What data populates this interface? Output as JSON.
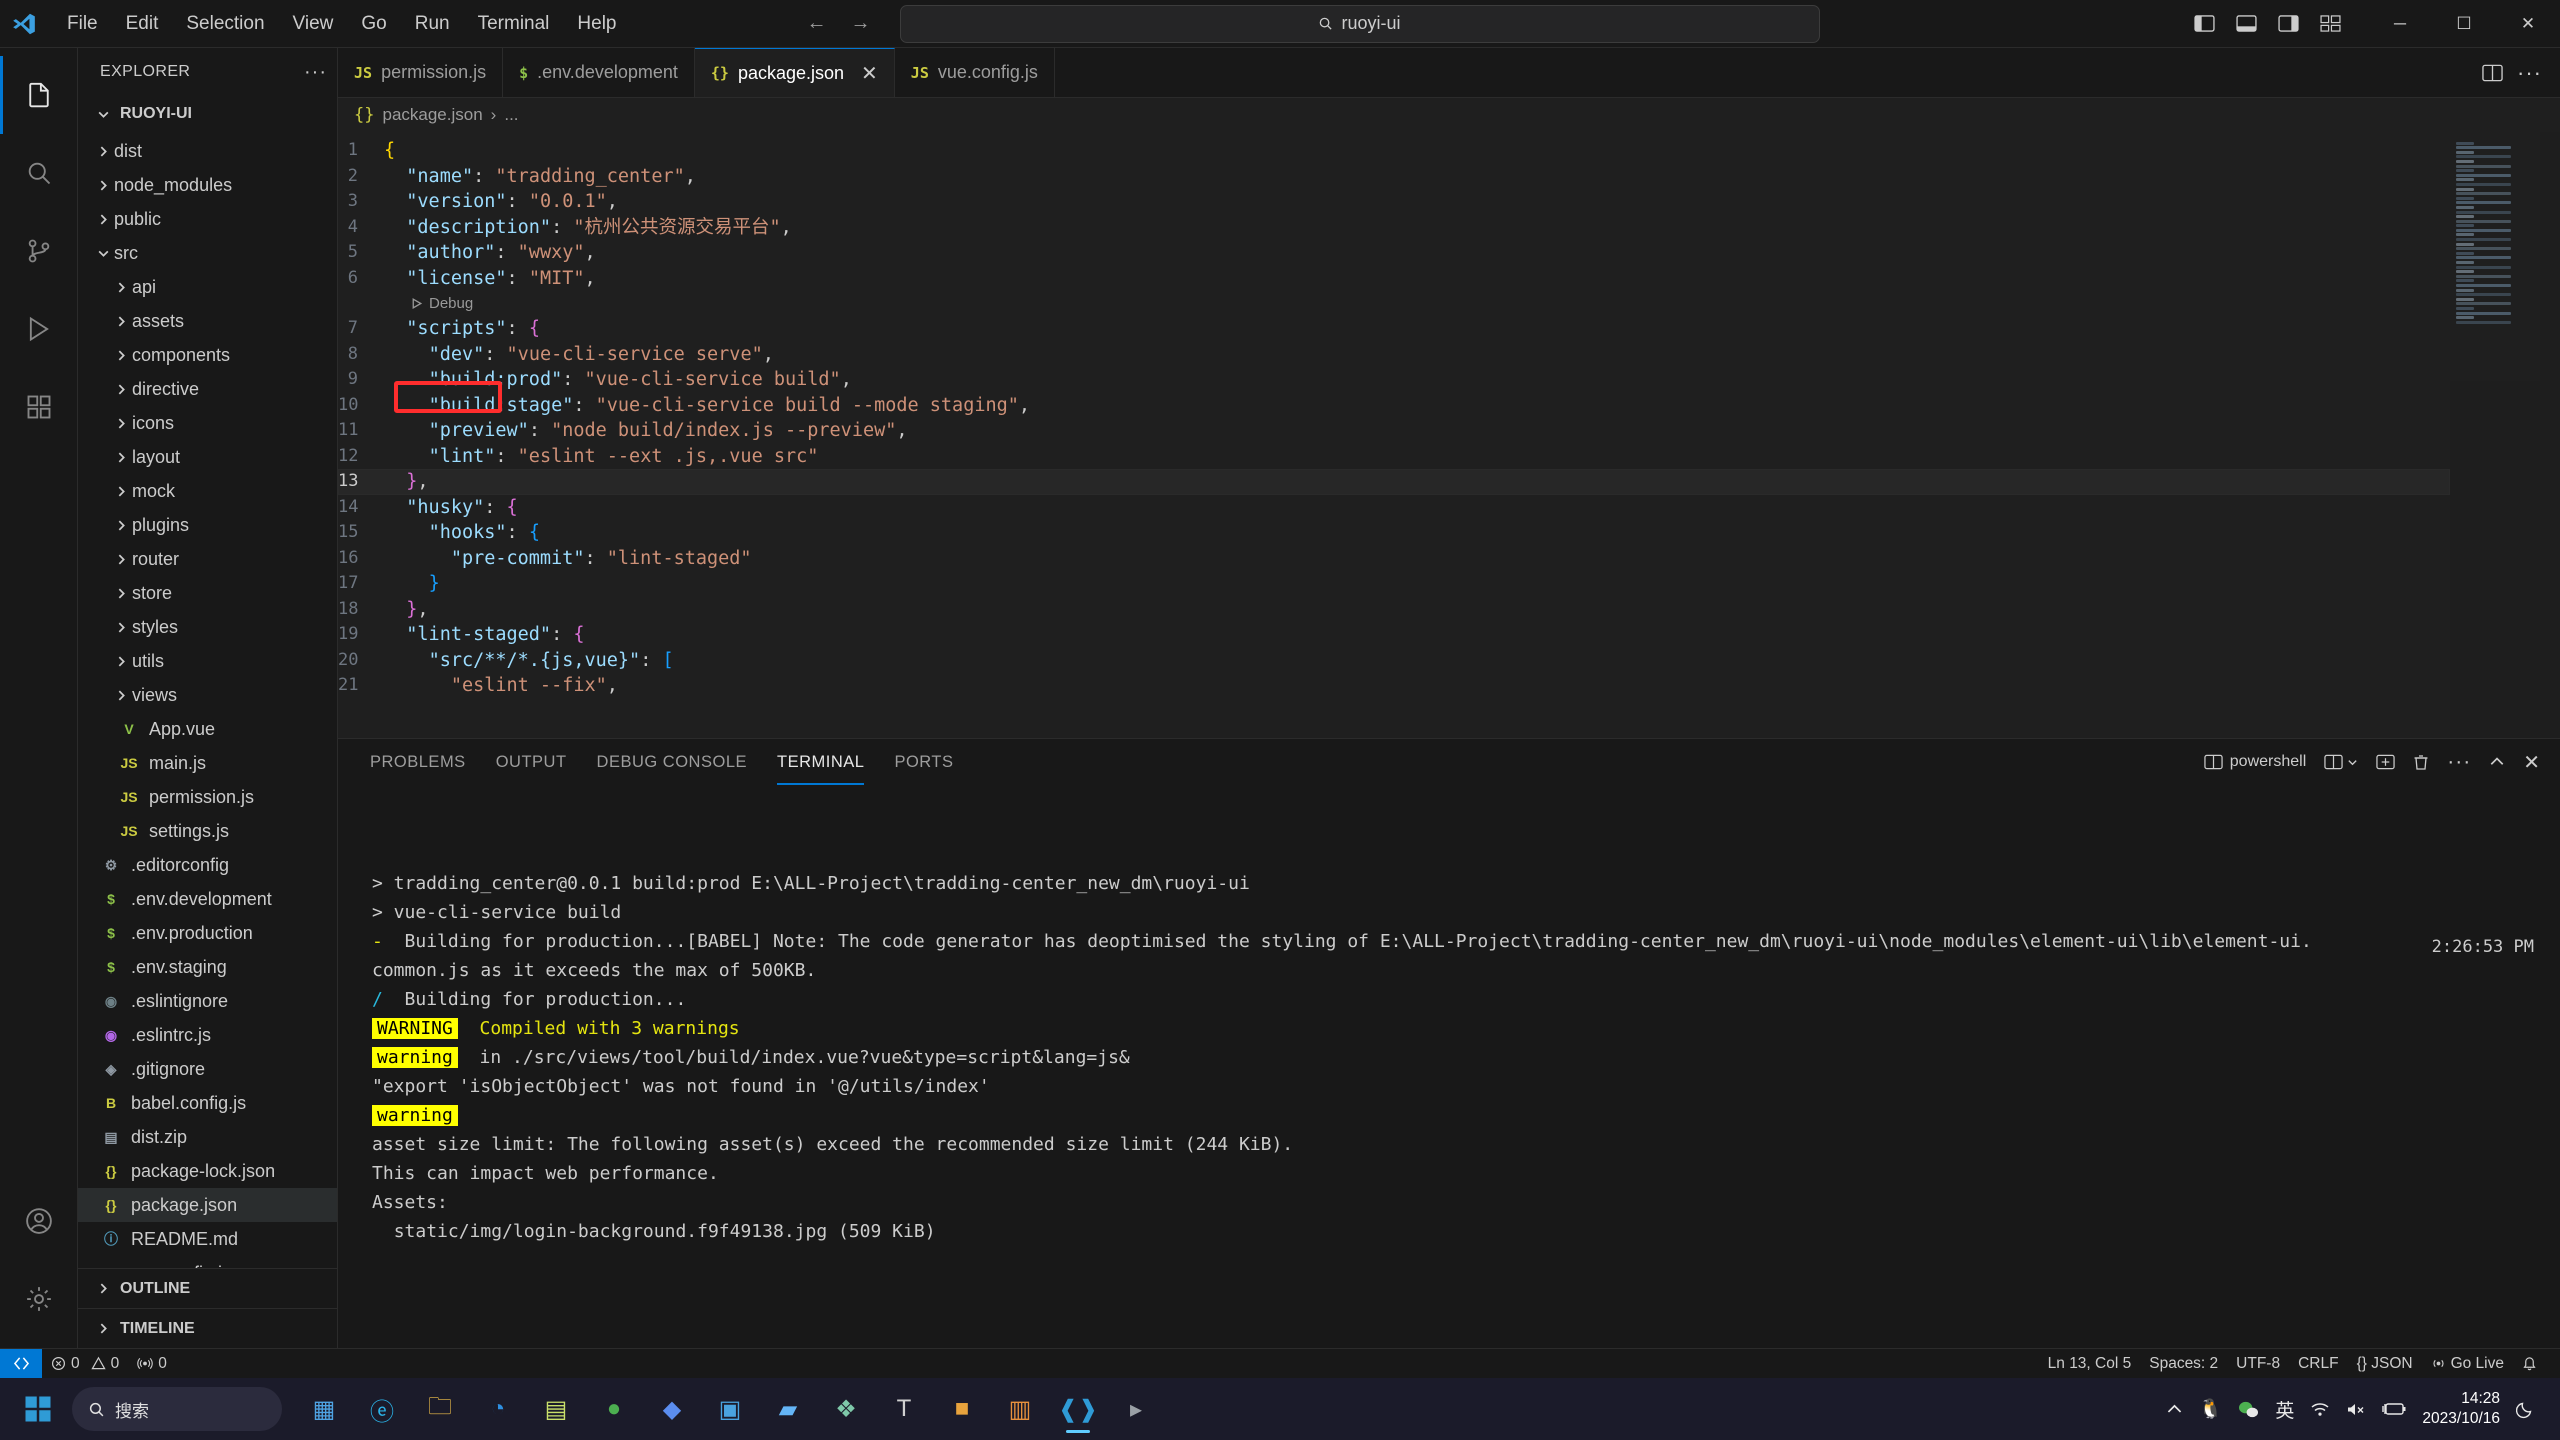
{
  "window": {
    "menu": [
      "File",
      "Edit",
      "Selection",
      "View",
      "Go",
      "Run",
      "Terminal",
      "Help"
    ],
    "command_center_text": "ruoyi-ui",
    "search_icon": "search-icon",
    "back_arrow": "←",
    "forward_arrow": "→",
    "minimize": "─",
    "maximize": "☐",
    "close": "✕"
  },
  "activitybar": {
    "items": [
      {
        "name": "explorer",
        "icon": "files-icon",
        "active": true
      },
      {
        "name": "search",
        "icon": "search-icon",
        "active": false
      },
      {
        "name": "source-control",
        "icon": "source-control-icon",
        "active": false
      },
      {
        "name": "run-and-debug",
        "icon": "debug-icon",
        "active": false
      },
      {
        "name": "extensions",
        "icon": "extensions-icon",
        "active": false
      }
    ],
    "bottom": [
      {
        "name": "accounts",
        "icon": "account-icon"
      },
      {
        "name": "manage",
        "icon": "gear-icon"
      }
    ]
  },
  "sidebar": {
    "title": "EXPLORER",
    "more_actions": "···",
    "root_label": "RUOYI-UI",
    "tree": [
      {
        "label": "dist",
        "type": "folder",
        "expanded": false,
        "depth": 1
      },
      {
        "label": "node_modules",
        "type": "folder",
        "expanded": false,
        "depth": 1
      },
      {
        "label": "public",
        "type": "folder",
        "expanded": false,
        "depth": 1
      },
      {
        "label": "src",
        "type": "folder",
        "expanded": true,
        "depth": 1
      },
      {
        "label": "api",
        "type": "folder",
        "expanded": false,
        "depth": 2
      },
      {
        "label": "assets",
        "type": "folder",
        "expanded": false,
        "depth": 2
      },
      {
        "label": "components",
        "type": "folder",
        "expanded": false,
        "depth": 2
      },
      {
        "label": "directive",
        "type": "folder",
        "expanded": false,
        "depth": 2
      },
      {
        "label": "icons",
        "type": "folder",
        "expanded": false,
        "depth": 2
      },
      {
        "label": "layout",
        "type": "folder",
        "expanded": false,
        "depth": 2
      },
      {
        "label": "mock",
        "type": "folder",
        "expanded": false,
        "depth": 2
      },
      {
        "label": "plugins",
        "type": "folder",
        "expanded": false,
        "depth": 2
      },
      {
        "label": "router",
        "type": "folder",
        "expanded": false,
        "depth": 2
      },
      {
        "label": "store",
        "type": "folder",
        "expanded": false,
        "depth": 2
      },
      {
        "label": "styles",
        "type": "folder",
        "expanded": false,
        "depth": 2
      },
      {
        "label": "utils",
        "type": "folder",
        "expanded": false,
        "depth": 2
      },
      {
        "label": "views",
        "type": "folder",
        "expanded": false,
        "depth": 2
      },
      {
        "label": "App.vue",
        "type": "file",
        "icon": "vue-icon",
        "glyph": "V",
        "color": "#8dc149",
        "depth": 2
      },
      {
        "label": "main.js",
        "type": "file",
        "icon": "js-icon",
        "glyph": "JS",
        "color": "#cbcb41",
        "depth": 2
      },
      {
        "label": "permission.js",
        "type": "file",
        "icon": "js-icon",
        "glyph": "JS",
        "color": "#cbcb41",
        "depth": 2
      },
      {
        "label": "settings.js",
        "type": "file",
        "icon": "js-icon",
        "glyph": "JS",
        "color": "#cbcb41",
        "depth": 2
      },
      {
        "label": ".editorconfig",
        "type": "file",
        "icon": "gear-icon",
        "glyph": "⚙",
        "color": "#8f99a3",
        "depth": 1
      },
      {
        "label": ".env.development",
        "type": "file",
        "icon": "dollar-icon",
        "glyph": "$",
        "color": "#8dc149",
        "depth": 1
      },
      {
        "label": ".env.production",
        "type": "file",
        "icon": "dollar-icon",
        "glyph": "$",
        "color": "#8dc149",
        "depth": 1
      },
      {
        "label": ".env.staging",
        "type": "file",
        "icon": "dollar-icon",
        "glyph": "$",
        "color": "#8dc149",
        "depth": 1
      },
      {
        "label": ".eslintignore",
        "type": "file",
        "icon": "eslint-icon",
        "glyph": "◉",
        "color": "#6d8086",
        "depth": 1
      },
      {
        "label": ".eslintrc.js",
        "type": "file",
        "icon": "eslint-icon",
        "glyph": "◉",
        "color": "#b267e6",
        "depth": 1
      },
      {
        "label": ".gitignore",
        "type": "file",
        "icon": "git-icon",
        "glyph": "◈",
        "color": "#8f99a3",
        "depth": 1
      },
      {
        "label": "babel.config.js",
        "type": "file",
        "icon": "babel-icon",
        "glyph": "B",
        "color": "#cbcb41",
        "depth": 1
      },
      {
        "label": "dist.zip",
        "type": "file",
        "icon": "zip-icon",
        "glyph": "▤",
        "color": "#8f99a3",
        "depth": 1
      },
      {
        "label": "package-lock.json",
        "type": "file",
        "icon": "json-icon",
        "glyph": "{}",
        "color": "#cbcb41",
        "depth": 1
      },
      {
        "label": "package.json",
        "type": "file",
        "icon": "json-icon",
        "glyph": "{}",
        "color": "#cbcb41",
        "depth": 1,
        "selected": true
      },
      {
        "label": "README.md",
        "type": "file",
        "icon": "info-icon",
        "glyph": "ⓘ",
        "color": "#519aba",
        "depth": 1
      },
      {
        "label": "vue.config.js",
        "type": "file",
        "icon": "js-icon",
        "glyph": "JS",
        "color": "#cbcb41",
        "depth": 1
      }
    ],
    "sections": [
      {
        "label": "OUTLINE"
      },
      {
        "label": "TIMELINE"
      }
    ]
  },
  "editor": {
    "tabs": [
      {
        "label": "permission.js",
        "glyph": "JS",
        "color": "#cbcb41",
        "active": false,
        "close": ""
      },
      {
        "label": ".env.development",
        "glyph": "$",
        "color": "#8dc149",
        "active": false,
        "close": ""
      },
      {
        "label": "package.json",
        "glyph": "{}",
        "color": "#cbcb41",
        "active": true,
        "close": "✕"
      },
      {
        "label": "vue.config.js",
        "glyph": "JS",
        "color": "#cbcb41",
        "active": false,
        "close": ""
      }
    ],
    "actions": [
      "split-editor-icon",
      "more-actions-icon"
    ],
    "breadcrumb": {
      "glyph": "{}",
      "file": "package.json",
      "sep": "›",
      "rest": "..."
    },
    "codelens": "Debug",
    "highlight_label": "build:prod",
    "lines": [
      {
        "n": "1",
        "html": "<span class='br1'>{</span>"
      },
      {
        "n": "2",
        "html": "  <span class='k'>\"name\"</span><span class='p'>: </span><span class='s'>\"tradding_center\"</span><span class='p'>,</span>"
      },
      {
        "n": "3",
        "html": "  <span class='k'>\"version\"</span><span class='p'>: </span><span class='s'>\"0.0.1\"</span><span class='p'>,</span>"
      },
      {
        "n": "4",
        "html": "  <span class='k'>\"description\"</span><span class='p'>: </span><span class='s'>\"杭州公共资源交易平台\"</span><span class='p'>,</span>"
      },
      {
        "n": "5",
        "html": "  <span class='k'>\"author\"</span><span class='p'>: </span><span class='s'>\"wwxy\"</span><span class='p'>,</span>"
      },
      {
        "n": "6",
        "html": "  <span class='k'>\"license\"</span><span class='p'>: </span><span class='s'>\"MIT\"</span><span class='p'>,</span>"
      },
      {
        "n": "7",
        "html": "  <span class='k'>\"scripts\"</span><span class='p'>: </span><span class='br2'>{</span>"
      },
      {
        "n": "8",
        "html": "    <span class='k'>\"dev\"</span><span class='p'>: </span><span class='s'>\"vue-cli-service serve\"</span><span class='p'>,</span>"
      },
      {
        "n": "9",
        "html": "    <span class='k'>\"build:prod\"</span><span class='p'>: </span><span class='s'>\"vue-cli-service build\"</span><span class='p'>,</span>"
      },
      {
        "n": "10",
        "html": "    <span class='k'>\"build:stage\"</span><span class='p'>: </span><span class='s'>\"vue-cli-service build --mode staging\"</span><span class='p'>,</span>"
      },
      {
        "n": "11",
        "html": "    <span class='k'>\"preview\"</span><span class='p'>: </span><span class='s'>\"node build/index.js --preview\"</span><span class='p'>,</span>"
      },
      {
        "n": "12",
        "html": "    <span class='k'>\"lint\"</span><span class='p'>: </span><span class='s'>\"eslint --ext .js,.vue src\"</span>"
      },
      {
        "n": "13",
        "html": "  <span class='br2'>}</span><span class='p'>,</span>",
        "current": true
      },
      {
        "n": "14",
        "html": "  <span class='k'>\"husky\"</span><span class='p'>: </span><span class='br2'>{</span>"
      },
      {
        "n": "15",
        "html": "    <span class='k'>\"hooks\"</span><span class='p'>: </span><span class='br3'>{</span>"
      },
      {
        "n": "16",
        "html": "      <span class='k'>\"pre-commit\"</span><span class='p'>: </span><span class='s'>\"lint-staged\"</span>"
      },
      {
        "n": "17",
        "html": "    <span class='br3'>}</span>"
      },
      {
        "n": "18",
        "html": "  <span class='br2'>}</span><span class='p'>,</span>"
      },
      {
        "n": "19",
        "html": "  <span class='k'>\"lint-staged\"</span><span class='p'>: </span><span class='br2'>{</span>"
      },
      {
        "n": "20",
        "html": "    <span class='k'>\"src/**/*.{js,vue}\"</span><span class='p'>: </span><span class='br3'>[</span>"
      },
      {
        "n": "21",
        "html": "      <span class='s'>\"eslint --fix\"</span><span class='p'>,</span>"
      }
    ]
  },
  "panel": {
    "tabs": [
      {
        "label": "PROBLEMS",
        "active": false
      },
      {
        "label": "OUTPUT",
        "active": false
      },
      {
        "label": "DEBUG CONSOLE",
        "active": false
      },
      {
        "label": "TERMINAL",
        "active": true
      },
      {
        "label": "PORTS",
        "active": false
      }
    ],
    "shell_label": "powershell",
    "actions": [
      "split-terminal-icon",
      "new-terminal-icon",
      "kill-terminal-icon",
      "more-icon",
      "chevron-up-icon",
      "close-icon"
    ],
    "timestamp": "2:26:53 PM",
    "terminal_lines": [
      "> tradding_center@0.0.1 build:prod E:\\ALL-Project\\tradding-center_new_dm\\ruoyi-ui",
      "> vue-cli-service build",
      "",
      "",
      "-  Building for production...[BABEL] Note: The code generator has deoptimised the styling of E:\\ALL-Project\\tradding-center_new_dm\\ruoyi-ui\\node_modules\\element-ui\\lib\\element-ui.",
      "common.js as it exceeds the max of 500KB.",
      "/  Building for production...",
      "",
      "WARNING_BADGE Compiled with 3 warnings",
      "",
      "warning_badge in ./src/views/tool/build/index.vue?vue&type=script&lang=js&",
      "",
      "\"export 'isObjectObject' was not found in '@/utils/index'",
      "",
      "warning_badge",
      "",
      "asset size limit: The following asset(s) exceed the recommended size limit (244 KiB).",
      "This can impact web performance.",
      "Assets:",
      "  static/img/login-background.f9f49138.jpg (509 KiB)"
    ],
    "warning_badge_upper": "WARNING",
    "warning_badge_lower": "warning",
    "warning_headline": "Compiled with 3 warnings",
    "warning_file": "in ./src/views/tool/build/index.vue?vue&type=script&lang=js&"
  },
  "statusbar": {
    "remote_icon": "remote-icon",
    "errors": "0",
    "warnings": "0",
    "ports": "0",
    "right": [
      {
        "label": "Ln 13, Col 5",
        "name": "cursor-position"
      },
      {
        "label": "Spaces: 2",
        "name": "indentation"
      },
      {
        "label": "UTF-8",
        "name": "encoding"
      },
      {
        "label": "CRLF",
        "name": "eol"
      },
      {
        "label": "{} JSON",
        "name": "language-mode"
      },
      {
        "label": "Go Live",
        "name": "go-live"
      }
    ],
    "bell_icon": "bell-icon"
  },
  "taskbar": {
    "search_placeholder": "搜索",
    "apps": [
      {
        "name": "widgets",
        "glyph": "▦",
        "color": "#4fa3e3"
      },
      {
        "name": "edge-legacy",
        "glyph": "ⓔ",
        "color": "#2bb3e8"
      },
      {
        "name": "file-explorer",
        "glyph": "🗀",
        "color": "#f2c14a"
      },
      {
        "name": "edge",
        "glyph": "◔",
        "color": "#2e8fe0"
      },
      {
        "name": "notes",
        "glyph": "▤",
        "color": "#c9e06a"
      },
      {
        "name": "wechat",
        "glyph": "●",
        "color": "#4caf50"
      },
      {
        "name": "browser-alt",
        "glyph": "◆",
        "color": "#5b8def"
      },
      {
        "name": "folder-blue",
        "glyph": "▣",
        "color": "#4aa3df"
      },
      {
        "name": "photos",
        "glyph": "▰",
        "color": "#64b5f6"
      },
      {
        "name": "gallery",
        "glyph": "❖",
        "color": "#7ec8a9"
      },
      {
        "name": "word",
        "glyph": "T",
        "color": "#d0d0d0"
      },
      {
        "name": "camera",
        "glyph": "■",
        "color": "#e8a33d"
      },
      {
        "name": "office",
        "glyph": "▥",
        "color": "#e8913d"
      },
      {
        "name": "vscode",
        "glyph": "❰❱",
        "color": "#2f9bd6",
        "active": true
      },
      {
        "name": "terminal-app",
        "glyph": "▸",
        "color": "#9aa0a6"
      }
    ],
    "tray": [
      {
        "name": "show-hidden-icons",
        "glyph": "⌃"
      },
      {
        "name": "qq-icon",
        "glyph": "🐧"
      },
      {
        "name": "wechat-tray-icon",
        "glyph": "●"
      },
      {
        "name": "ime-icon",
        "glyph": "英"
      },
      {
        "name": "wifi-icon",
        "glyph": "◔"
      },
      {
        "name": "volume-muted-icon",
        "glyph": "🔇"
      },
      {
        "name": "battery-charging-icon",
        "glyph": "▭"
      }
    ],
    "time": "14:28",
    "date": "2023/10/16",
    "notification_icon": "moon-icon"
  },
  "colors": {
    "accent": "#0078d4",
    "highlight_box": "#ff2d2d",
    "warn_bg": "#ffff00",
    "warn_text": "#e5e510"
  }
}
